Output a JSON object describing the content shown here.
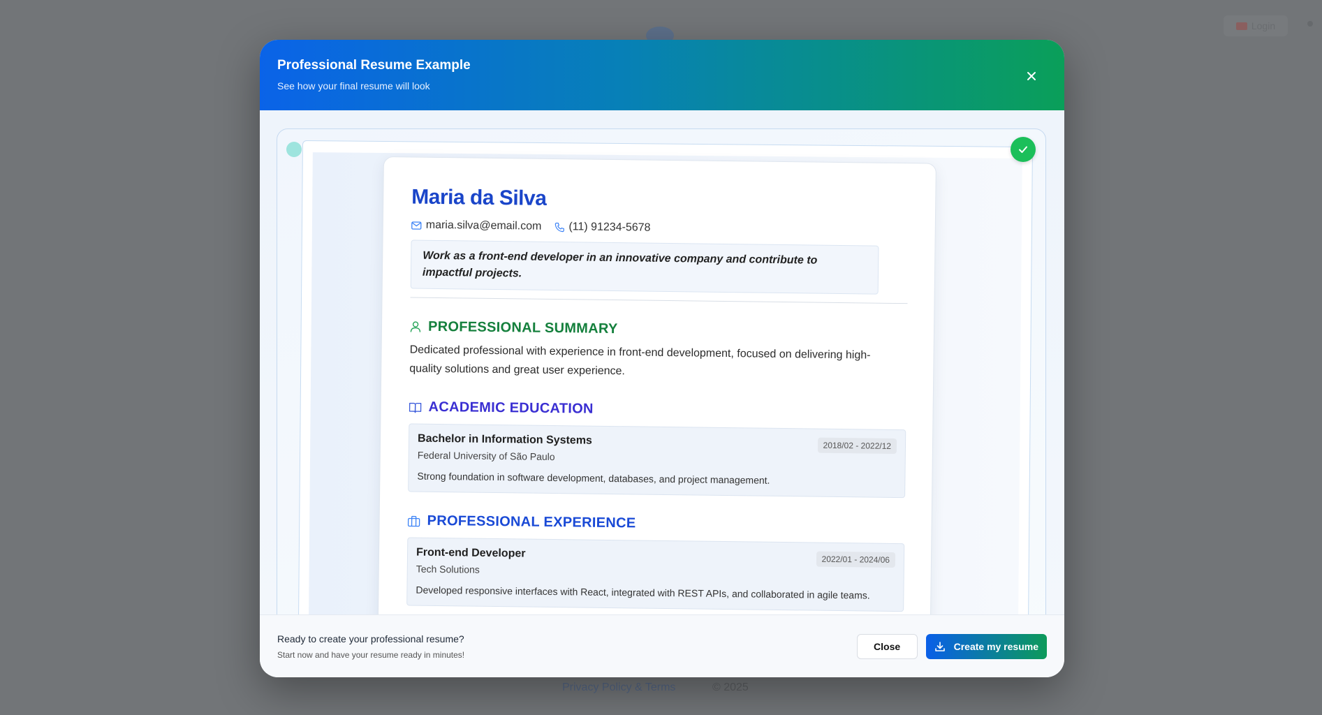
{
  "background": {
    "login_label": "Login",
    "footer_link": "Privacy Policy & Terms",
    "footer_text": "© 2025"
  },
  "modal": {
    "title": "Professional Resume Example",
    "subtitle": "See how your final resume will look",
    "close_icon": "close-icon"
  },
  "resume": {
    "name": "Maria da Silva",
    "email": "maria.silva@email.com",
    "phone": "(11) 91234-5678",
    "objective": "Work as a front-end developer in an innovative company and contribute to impactful projects.",
    "summary_title": "PROFESSIONAL SUMMARY",
    "summary_text": "Dedicated professional with experience in front-end development, focused on delivering high-quality solutions and great user experience.",
    "education_title": "ACADEMIC EDUCATION",
    "education": [
      {
        "title": "Bachelor in Information Systems",
        "institution": "Federal University of São Paulo",
        "dates": "2018/02 - 2022/12",
        "description": "Strong foundation in software development, databases, and project management."
      }
    ],
    "experience_title": "PROFESSIONAL EXPERIENCE",
    "experience": [
      {
        "title": "Front-end Developer",
        "company": "Tech Solutions",
        "dates": "2022/01 - 2024/06",
        "description": "Developed responsive interfaces with React, integrated with REST APIs, and collaborated in agile teams."
      }
    ]
  },
  "footer": {
    "question": "Ready to create your professional resume?",
    "subtext": "Start now and have your resume ready in minutes!",
    "close_label": "Close",
    "create_label": "Create my resume"
  },
  "colors": {
    "header_start": "#0a63e8",
    "header_end": "#0a9f59",
    "name": "#1a45c9",
    "summary": "#15803d",
    "education": "#3a2fd2",
    "experience": "#1a4ad6",
    "check": "#1bbf5a"
  }
}
